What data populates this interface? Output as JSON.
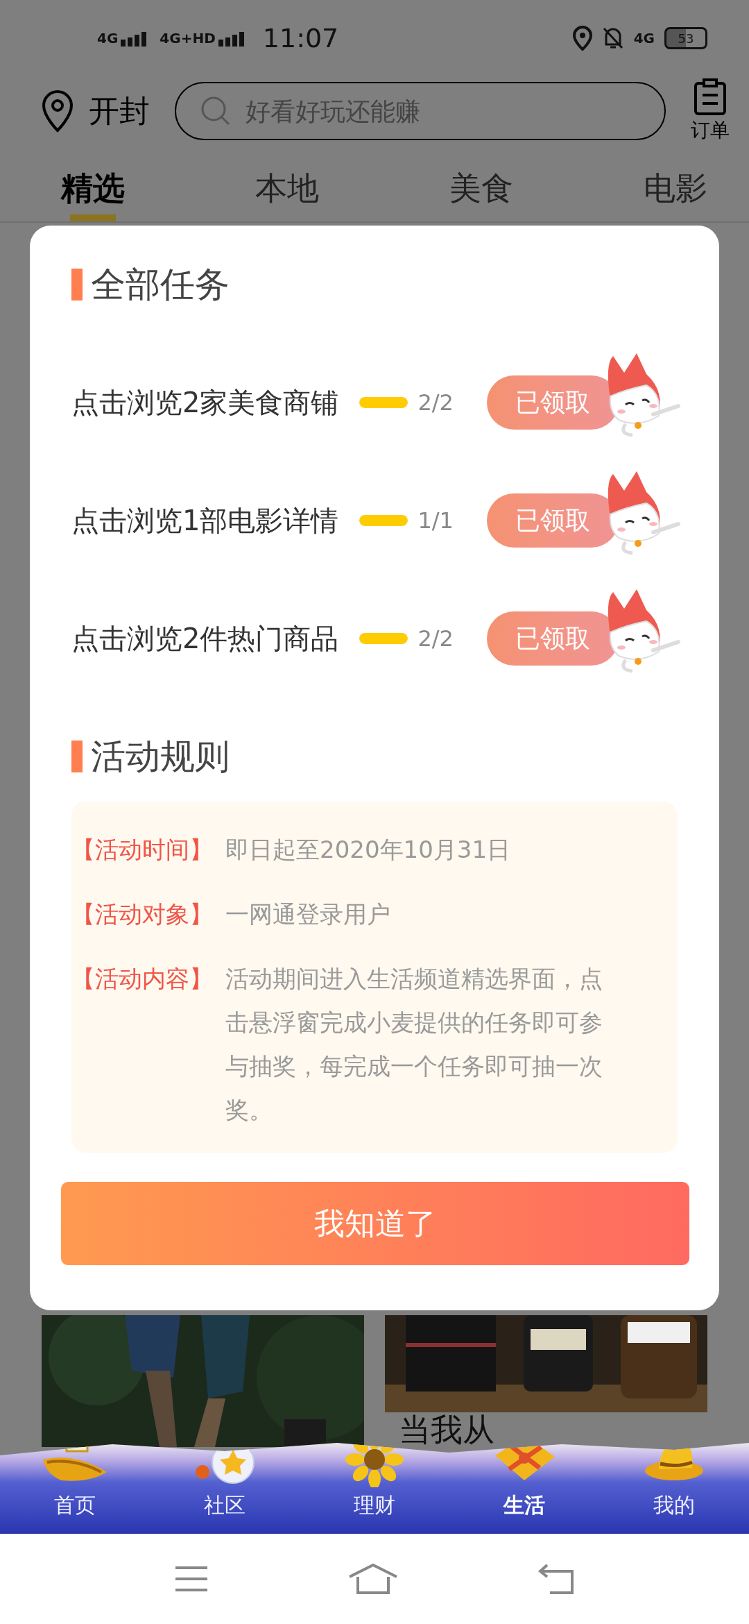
{
  "status_bar": {
    "signal_1": "4G",
    "signal_2": "4G+HD",
    "time": "11:07",
    "signal_3": "4G",
    "battery": "53"
  },
  "header": {
    "city": "开封",
    "search": {
      "placeholder": "好看好玩还能赚"
    },
    "orders_label": "订单"
  },
  "tabs": [
    {
      "label": "精选",
      "selected": true
    },
    {
      "label": "本地",
      "selected": false
    },
    {
      "label": "美食",
      "selected": false
    },
    {
      "label": "电影",
      "selected": false
    }
  ],
  "cards": [
    {
      "kind": "picture"
    },
    {
      "kind": "picture",
      "caption": "当我从"
    }
  ],
  "dialog": {
    "tasks_title": "全部任务",
    "tasks": [
      {
        "label": "点击浏览2家美食商铺",
        "level": 1,
        "progress": "2/2",
        "button": "已领取",
        "claimed": true
      },
      {
        "label": "点击浏览1部电影详情",
        "level": 1,
        "progress": "1/1",
        "button": "已领取",
        "claimed": true
      },
      {
        "label": "点击浏览2件热门商品",
        "level": 1,
        "progress": "2/2",
        "button": "已领取",
        "claimed": true
      }
    ],
    "rules_title": "活动规则",
    "rules": [
      {
        "term": "【活动时间】",
        "text": "即日起至2020年10月31日"
      },
      {
        "term": "【活动对象】",
        "text": "一网通登录用户"
      },
      {
        "term": "【活动内容】",
        "text": "活动期间进入生活频道精选界面，点击悬浮窗完成小麦提供的任务即可参与抽奖，每完成一个任务即可抽一次奖。"
      }
    ],
    "confirm_button": "我知道了"
  },
  "bottom_nav": [
    {
      "label": "首页",
      "kind": "boat",
      "selected": false
    },
    {
      "label": "社区",
      "kind": "bottle",
      "selected": false
    },
    {
      "label": "理财",
      "kind": "flower",
      "selected": false
    },
    {
      "label": "生活",
      "kind": "gift",
      "selected": true
    },
    {
      "label": "我的",
      "kind": "hat",
      "selected": false
    }
  ]
}
